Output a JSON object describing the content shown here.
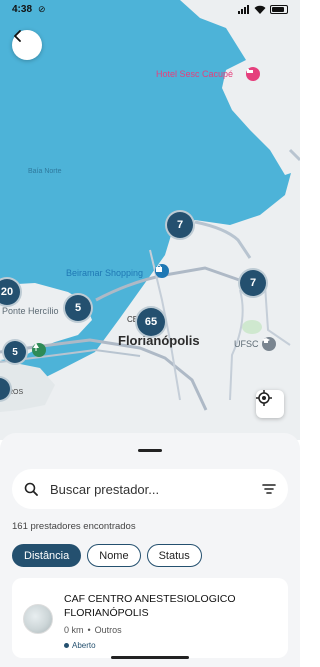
{
  "status_bar": {
    "time": "4:38"
  },
  "map": {
    "labels": {
      "hotel": "Hotel Sesc Cacupé",
      "bay": "Baía Norte",
      "mall": "Beiramar Shopping",
      "bridge": "Ponte Hercílio",
      "centro": "CE",
      "city": "Florianópolis",
      "ufsc": "UFSC",
      "partial": "IROS"
    },
    "clusters": [
      "7",
      "7",
      "5",
      "65",
      "20",
      "5"
    ]
  },
  "sheet": {
    "search_placeholder": "Buscar prestador...",
    "result_count": "161 prestadores encontrados",
    "chips": [
      "Distância",
      "Nome",
      "Status"
    ],
    "card": {
      "name": "CAF CENTRO ANESTESIOLOGICO FLORIANÓPOLIS",
      "distance": "0 km",
      "category": "Outros",
      "status": "Aberto"
    }
  },
  "colors": {
    "accent": "#24506f",
    "water": "#4db3d8",
    "land": "#eceff1",
    "hotel": "#e5407d"
  }
}
